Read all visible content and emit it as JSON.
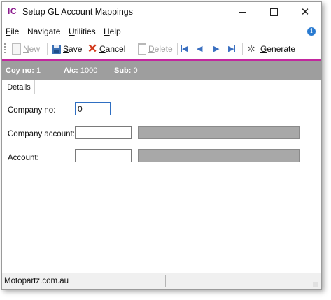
{
  "window": {
    "app_logo": "IC",
    "title": "Setup GL Account Mappings"
  },
  "menu": {
    "items": [
      {
        "label_u": "F",
        "label_rest": "ile"
      },
      {
        "label_u": "",
        "label_rest": "Navigate"
      },
      {
        "label_u": "U",
        "label_rest": "tilities"
      },
      {
        "label_u": "H",
        "label_rest": "elp"
      }
    ]
  },
  "toolbar": {
    "new_u": "N",
    "new_rest": "ew",
    "save_u": "S",
    "save_rest": "ave",
    "cancel_u": "C",
    "cancel_rest": "ancel",
    "delete_u": "D",
    "delete_rest": "elete",
    "generate_u": "G",
    "generate_rest": "enerate"
  },
  "infobar": {
    "coy_label": "Coy no:",
    "coy_value": "1",
    "ac_label": "A/c:",
    "ac_value": "1000",
    "sub_label": "Sub:",
    "sub_value": "0"
  },
  "tabs": {
    "details": "Details"
  },
  "form": {
    "company_no_label": "Company no:",
    "company_no_value": "0",
    "company_account_label": "Company account:",
    "company_account_value": "",
    "account_label": "Account:",
    "account_value": ""
  },
  "status": {
    "text": "Motopartz.com.au"
  },
  "colors": {
    "accent": "#c2279e",
    "infobar": "#9e9e9e",
    "nav_arrows": "#3a6fc0"
  }
}
